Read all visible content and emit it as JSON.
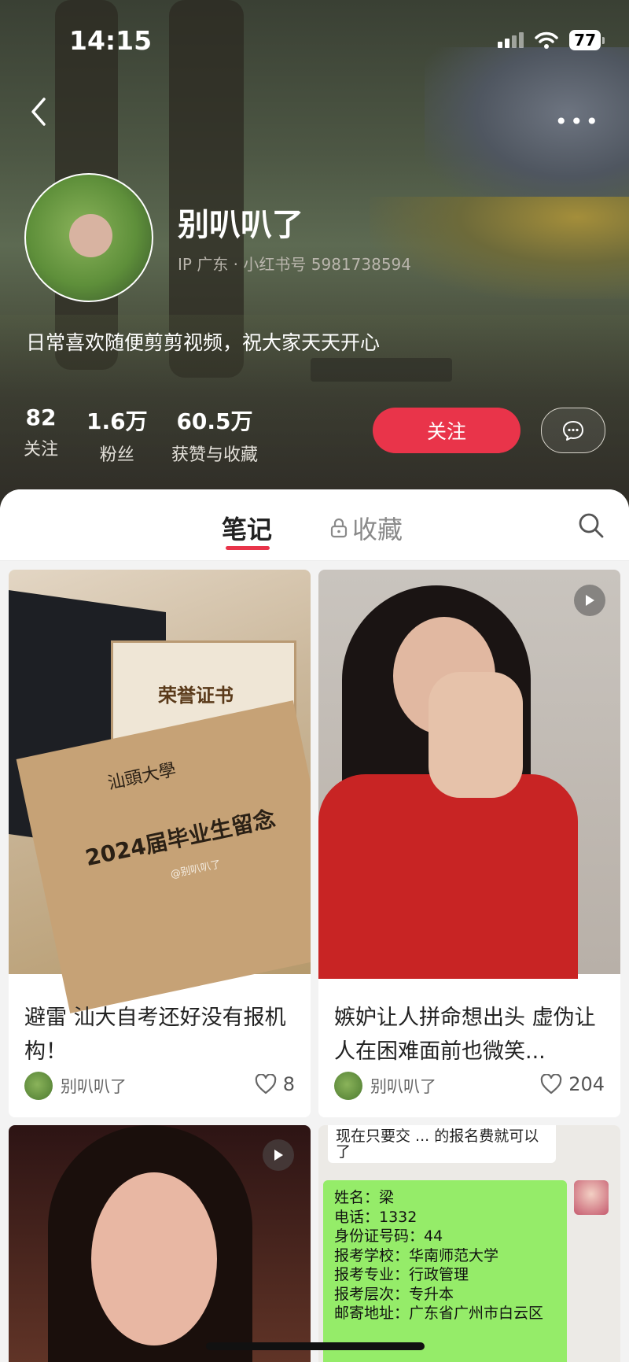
{
  "status_bar": {
    "time": "14:15",
    "battery": "77"
  },
  "profile": {
    "nickname": "别叭叭了",
    "id_line": "IP 广东 · 小红书号 5981738594",
    "bio": "日常喜欢随便剪剪视频，祝大家天天开心",
    "stats": [
      {
        "value": "82",
        "label": "关注"
      },
      {
        "value": "1.6万",
        "label": "粉丝"
      },
      {
        "value": "60.5万",
        "label": "获赞与收藏"
      }
    ],
    "follow_label": "关注"
  },
  "tabs": {
    "notes": "笔记",
    "favorites": "收藏"
  },
  "notes": [
    {
      "title": "避雷 汕大自考还好没有报机构！",
      "author": "别叭叭了",
      "likes": "8",
      "image_text": {
        "certificate": "荣誉证书",
        "folder": "2024届毕业生留念",
        "university": "汕頭大學",
        "watermark": "@别叭叭了"
      }
    },
    {
      "title": "嫉妒让人拼命想出头 虚伪让人在困难面前也微笑...",
      "author": "别叭叭了",
      "likes": "204",
      "is_video": true
    },
    {
      "is_video": true
    },
    {
      "chat_top": "现在只要交 ... 的报名费就可以了",
      "chat_lines": [
        "姓名：梁",
        "电话：1332",
        "身份证号码：44",
        "报考学校：华南师范大学",
        "报考专业：行政管理",
        "报考层次：专升本",
        "邮寄地址：广东省广州市白云区"
      ]
    }
  ],
  "colors": {
    "accent": "#e9344a",
    "chat_green": "#95ec69"
  }
}
